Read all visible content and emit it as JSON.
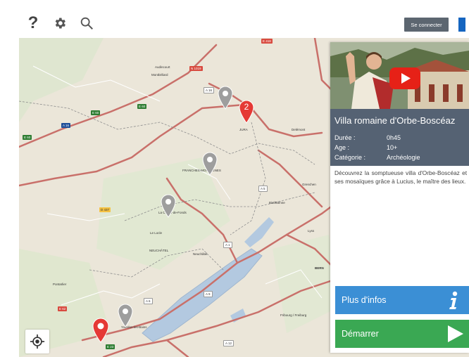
{
  "toolbar": {
    "help_label": "?",
    "connect_label": "Se connecter"
  },
  "map": {
    "labels": {
      "pontarlier": "Pontarlier",
      "neuchatel": "Neuchâtel",
      "bern": "BERN",
      "le_locle": "Le Locle",
      "la_chaux": "La Chaux-de-Fonds",
      "biel": "Biel/Bienne",
      "grenchen": "Grenchen",
      "delemont": "Delémont",
      "jura": "JURA",
      "fribourg": "Fribourg / Freiburg",
      "yverdon": "Yverdon-les-Bains",
      "montbeliard": "Montbéliard",
      "audincourt": "Audincourt",
      "neuchatel_region": "NEUCHÂTEL",
      "franches": "FRANCHES-MONTAGNES",
      "lyss": "Lyss"
    },
    "roads": [
      "E 60",
      "A 16",
      "A 16",
      "N 1019",
      "E 418",
      "A 5",
      "A 1",
      "A 6",
      "A 9",
      "A 12",
      "E 23",
      "E 62",
      "D 437",
      "A 16",
      "A 5"
    ],
    "cluster_marker_count": "2"
  },
  "panel": {
    "title": "Villa romaine d'Orbe-Boscéaz",
    "duration_label": "Durée :",
    "duration_value": "0h45",
    "age_label": "Age :",
    "age_value": "10+",
    "category_label": "Catégorie :",
    "category_value": "Archéologie",
    "description": "Découvrez la somptueuse villa d'Orbe-Boscéaz et ses mosaïques grâce à Lucius, le maître des lieux.",
    "more_info_label": "Plus d'infos",
    "start_label": "Démarrer"
  },
  "colors": {
    "panel_header": "#556273",
    "more_info": "#3b8fd5",
    "start": "#3aa853",
    "marker_active": "#e53935",
    "marker_inactive": "#9e9e9e",
    "lake": "#b3c9e0"
  },
  "icons": {
    "help": "question-mark",
    "settings": "gear-icon",
    "search": "search-icon",
    "locate": "crosshair-icon",
    "info": "info-icon",
    "play": "play-icon",
    "youtube": "youtube-play-icon"
  }
}
